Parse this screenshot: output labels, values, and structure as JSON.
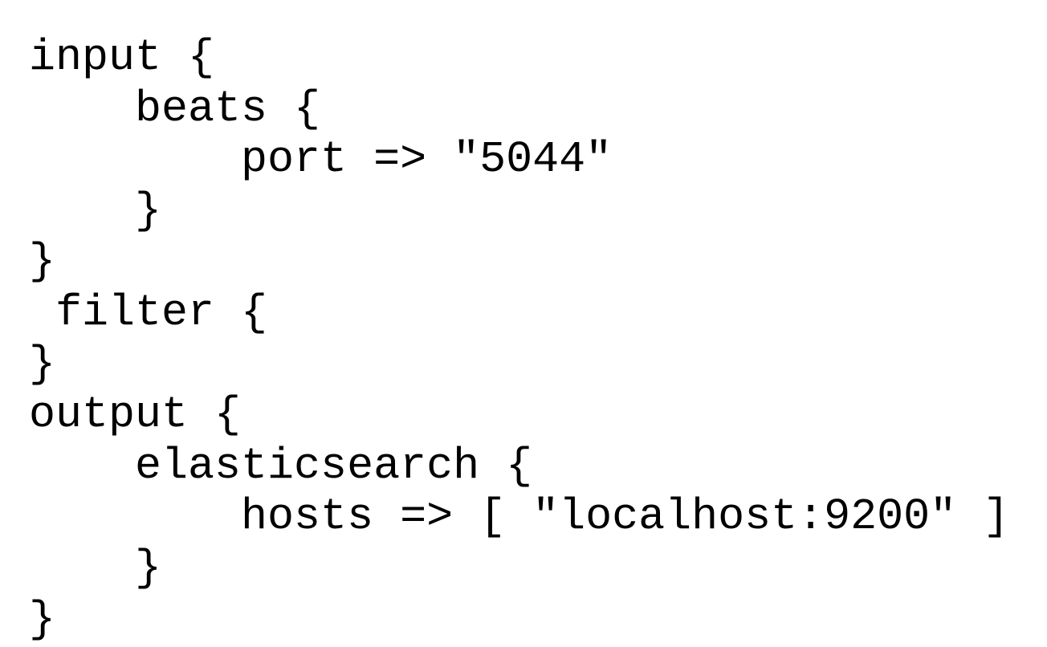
{
  "code": {
    "lines": [
      "input {",
      "    beats {",
      "        port => \"5044\"",
      "    }",
      "}",
      " filter {",
      "}",
      "output {",
      "    elasticsearch {",
      "        hosts => [ \"localhost:9200\" ]",
      "    }",
      "}"
    ]
  }
}
